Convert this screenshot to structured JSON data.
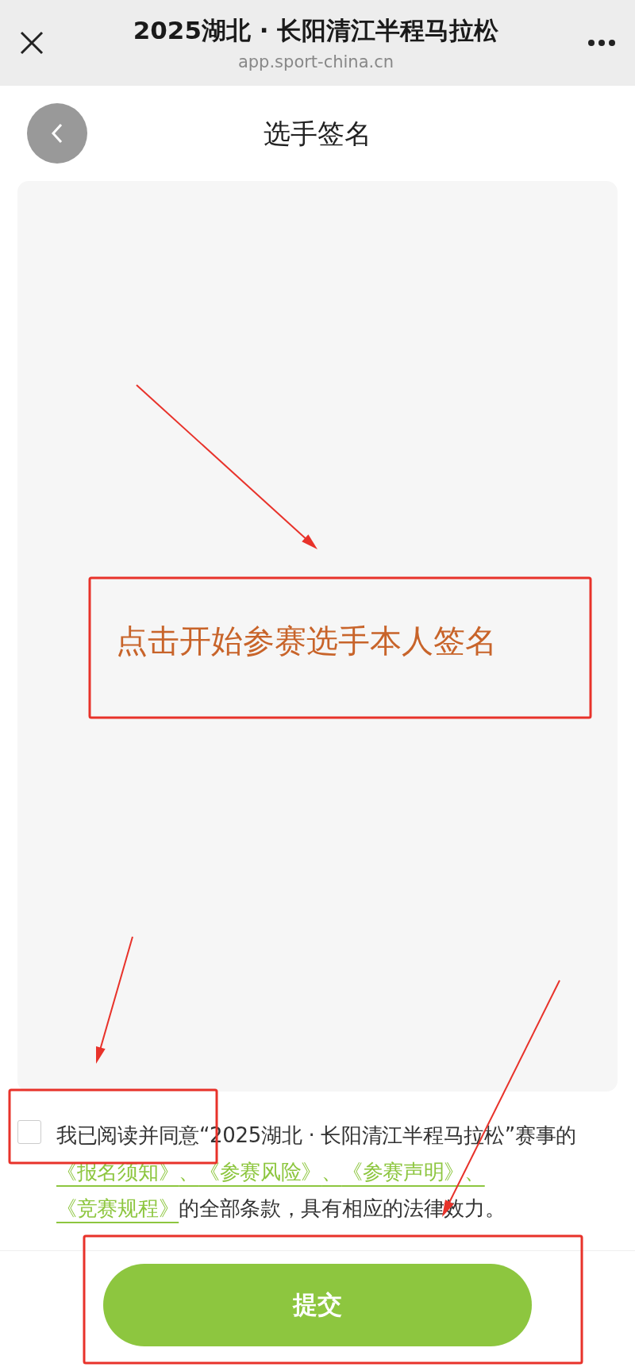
{
  "browser_bar": {
    "title": "2025湖北 · 长阳清江半程马拉松",
    "url": "app.sport-china.cn"
  },
  "page": {
    "title": "选手签名"
  },
  "signature_pad": {
    "annotation": "点击开始参赛选手本人签名"
  },
  "agreement": {
    "checked": false,
    "parts": [
      {
        "kind": "text",
        "text": "我已阅读并同意“2025湖北 · 长阳清江半程马拉松”赛事的"
      },
      {
        "kind": "link",
        "text": "《报名须知》"
      },
      {
        "kind": "sep",
        "text": "、"
      },
      {
        "kind": "link",
        "text": "《参赛风险》"
      },
      {
        "kind": "sep",
        "text": "、"
      },
      {
        "kind": "link",
        "text": "《参赛声明》"
      },
      {
        "kind": "sep",
        "text": "、"
      },
      {
        "kind": "link",
        "text": "《竞赛规程》"
      },
      {
        "kind": "text",
        "text": "的全部条款，具有相应的法律效力。"
      }
    ]
  },
  "submit_button": {
    "label": "提交"
  }
}
